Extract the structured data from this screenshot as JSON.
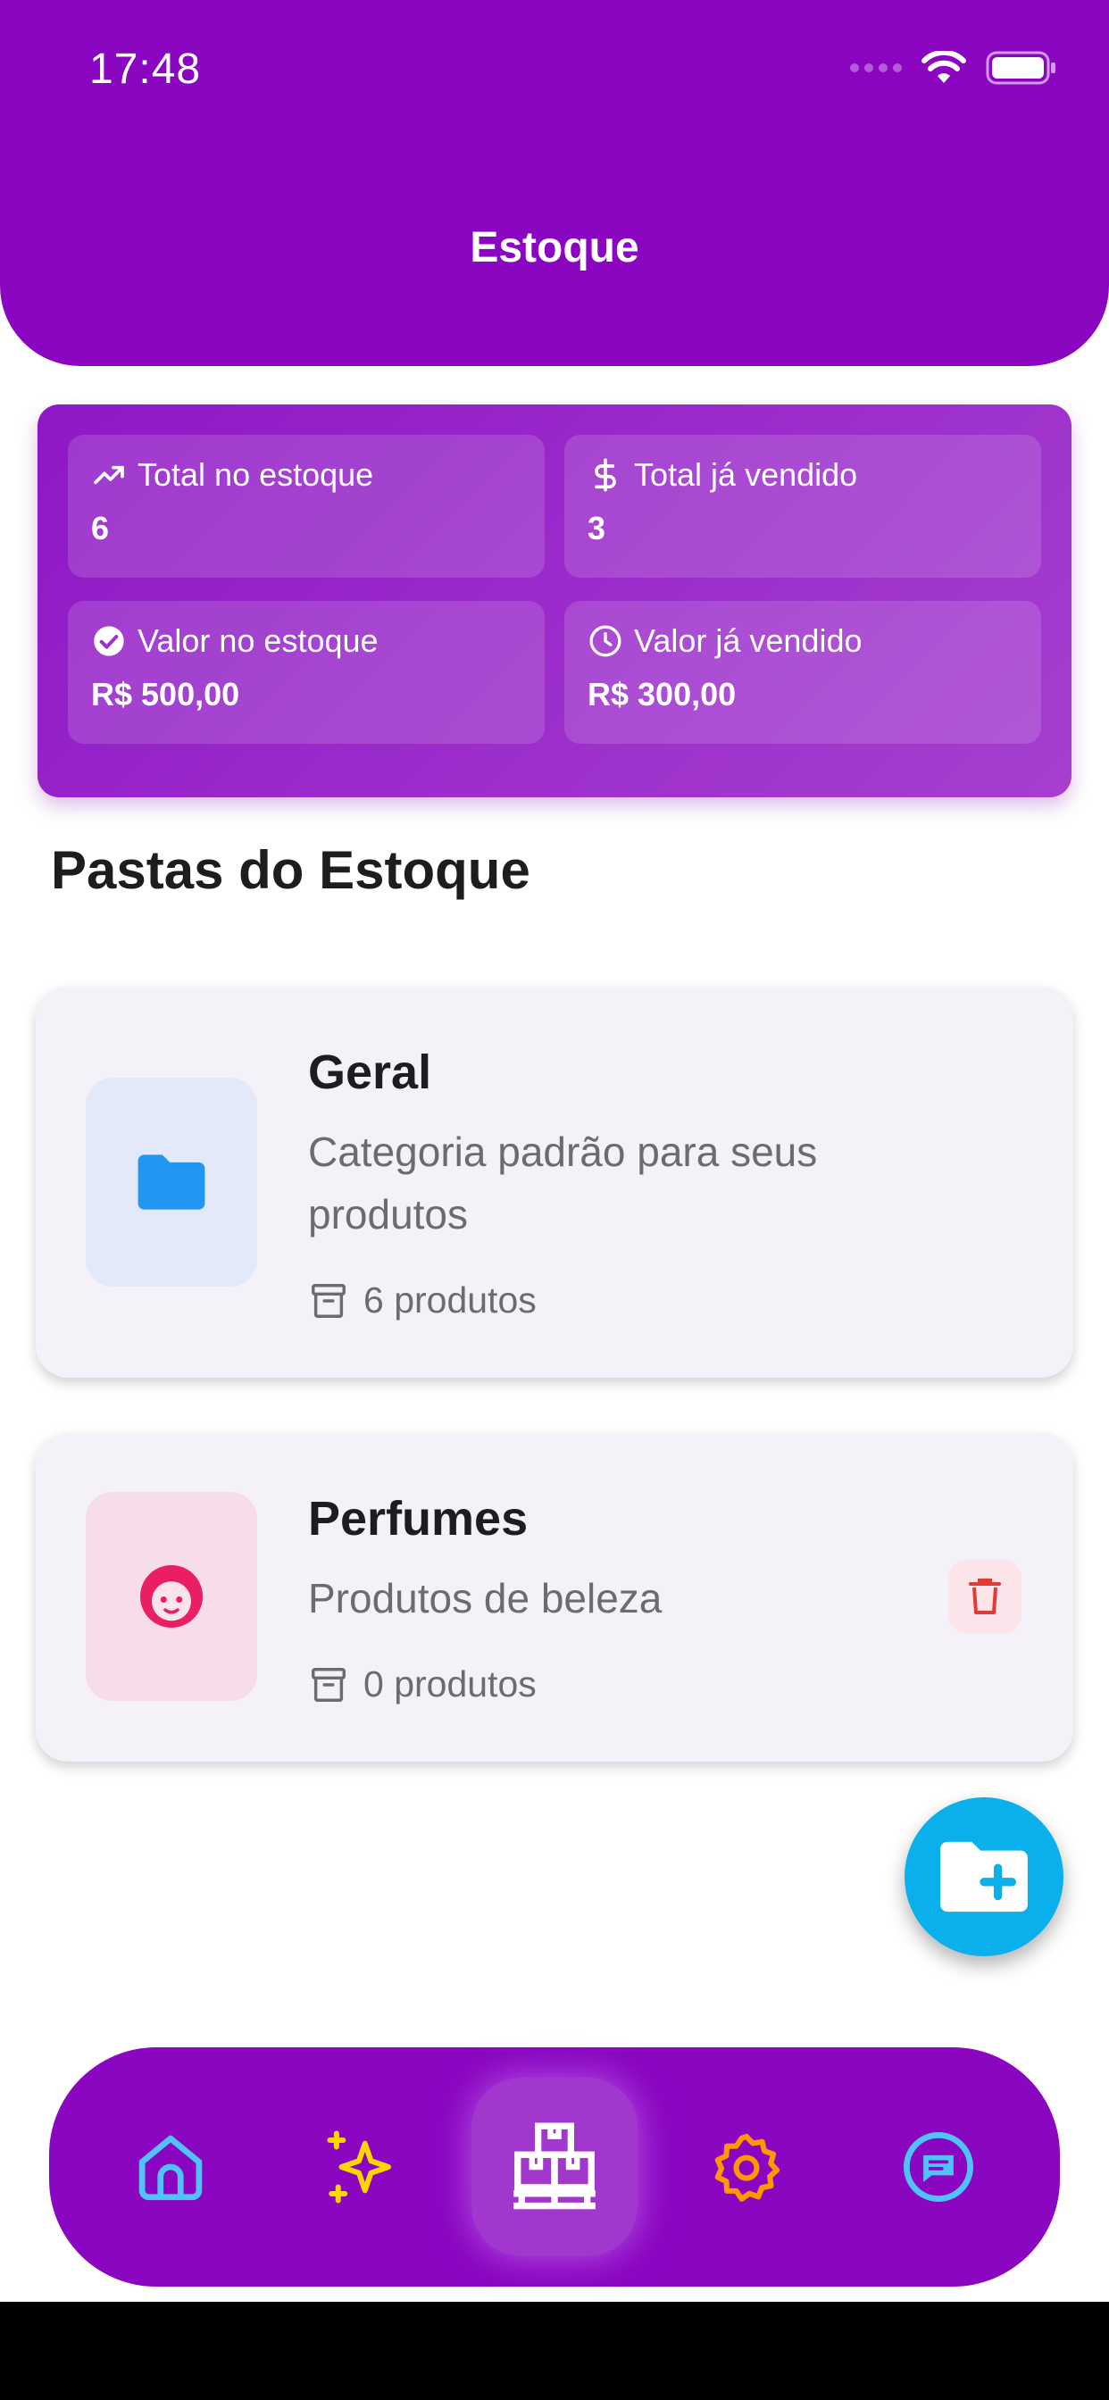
{
  "status_bar": {
    "time": "17:48"
  },
  "header": {
    "title": "Estoque"
  },
  "summary": {
    "total_stock": {
      "label": "Total no estoque",
      "value": "6"
    },
    "total_sold": {
      "label": "Total já vendido",
      "value": "3"
    },
    "stock_value": {
      "label": "Valor no estoque",
      "value": "R$ 500,00"
    },
    "sold_value": {
      "label": "Valor já vendido",
      "value": "R$ 300,00"
    }
  },
  "section": {
    "title": "Pastas do Estoque"
  },
  "folders": [
    {
      "name": "Geral",
      "description": "Categoria padrão para seus produtos",
      "count": "6 produtos",
      "icon": "folder-icon",
      "color": "#2196f3"
    },
    {
      "name": "Perfumes",
      "description": "Produtos de beleza",
      "count": "0 produtos",
      "icon": "face-icon",
      "color": "#e91e63"
    }
  ],
  "fab": {
    "icon": "add-folder-icon"
  },
  "nav": [
    {
      "icon": "home-icon",
      "color": "#4fc3f7"
    },
    {
      "icon": "sparkles-icon",
      "color": "#ffd600"
    },
    {
      "icon": "inventory-boxes-icon",
      "color": "#ffffff",
      "active": true
    },
    {
      "icon": "settings-gear-icon",
      "color": "#ff9800"
    },
    {
      "icon": "chat-icon",
      "color": "#4fc3f7"
    }
  ]
}
